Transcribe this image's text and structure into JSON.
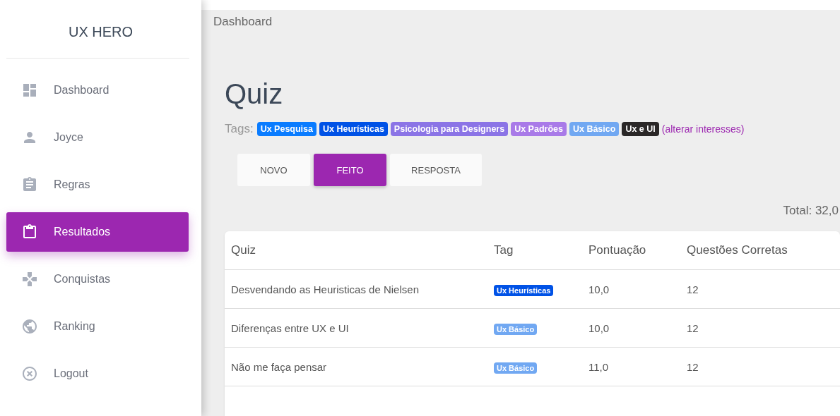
{
  "sidebar": {
    "brand": "UX HERO",
    "items": [
      {
        "kind": "dashboard",
        "label": "Dashboard",
        "selected": false
      },
      {
        "kind": "person",
        "label": "Joyce",
        "selected": false
      },
      {
        "kind": "rules",
        "label": "Regras",
        "selected": false
      },
      {
        "kind": "results",
        "label": "Resultados",
        "selected": true
      },
      {
        "kind": "games",
        "label": "Conquistas",
        "selected": false
      },
      {
        "kind": "globe",
        "label": "Ranking",
        "selected": false
      },
      {
        "kind": "logout",
        "label": "Logout",
        "selected": false
      }
    ]
  },
  "breadcrumb": "Dashboard",
  "title": "Quiz",
  "tags_label": "Tags:",
  "tags": [
    {
      "label": "Ux Pesquisa",
      "color": "#0a7cff"
    },
    {
      "label": "Ux Heurísticas",
      "color": "#0052e6"
    },
    {
      "label": "Psicologia para Designers",
      "color": "#8b74e6"
    },
    {
      "label": "Ux Padrões",
      "color": "#a97ae8"
    },
    {
      "label": "Ux Básico",
      "color": "#71a8f2"
    },
    {
      "label": "Ux e UI",
      "color": "#2a2727"
    }
  ],
  "tags_link": "(alterar interesses)",
  "tabs": [
    {
      "label": "NOVO",
      "selected": false
    },
    {
      "label": "FEITO",
      "selected": true
    },
    {
      "label": "RESPOSTA",
      "selected": false
    }
  ],
  "total": "Total: 32,0",
  "table": {
    "columns": [
      "Quiz",
      "Tag",
      "Pontuação",
      "Questões Corretas"
    ],
    "rows": [
      {
        "quiz": "Desvendando as Heuristicas de Nielsen",
        "tag": {
          "label": "Ux Heurísticas",
          "color": "#0052e6"
        },
        "score": "10,0",
        "correct": "12"
      },
      {
        "quiz": "Diferenças entre UX e UI",
        "tag": {
          "label": "Ux Básico",
          "color": "#71a8f2"
        },
        "score": "10,0",
        "correct": "12"
      },
      {
        "quiz": "Não me faça pensar",
        "tag": {
          "label": "Ux Básico",
          "color": "#71a8f2"
        },
        "score": "11,0",
        "correct": "12"
      }
    ]
  }
}
